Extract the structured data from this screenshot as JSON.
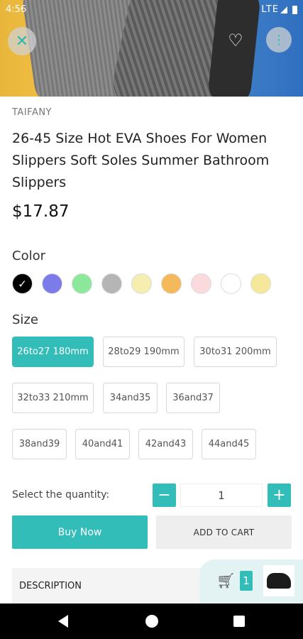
{
  "status": {
    "time": "4:56",
    "network": "LTE"
  },
  "product": {
    "brand": "TAIFANY",
    "title": "26-45 Size Hot EVA Shoes For Women Slippers Soft Soles Summer Bathroom Slippers",
    "price": "$17.87"
  },
  "color_section": {
    "label": "Color",
    "selected_index": 0,
    "swatches": [
      "#000000",
      "#7b7bea",
      "#8ee89b",
      "#b5b5b5",
      "#f5eeb0",
      "#f3b95a",
      "#fadadd",
      "#ffffff",
      "#f6e89a"
    ]
  },
  "size_section": {
    "label": "Size",
    "options": [
      "26to27 180mm",
      "28to29 190mm",
      "30to31 200mm",
      "32to33 210mm",
      "34and35",
      "36and37",
      "38and39",
      "40and41",
      "42and43",
      "44and45"
    ],
    "selected_index": 0
  },
  "quantity": {
    "label": "Select the quantity:",
    "value": "1",
    "minus": "−",
    "plus": "+"
  },
  "actions": {
    "buy_now": "Buy Now",
    "add_to_cart": "ADD TO CART"
  },
  "description": {
    "label": "DESCRIPTION"
  },
  "cart": {
    "count": "1"
  },
  "icons": {
    "close": "close-icon",
    "heart": "heart-icon",
    "more": "more-vert-icon",
    "cart": "cart-icon",
    "check": "check-icon"
  },
  "colors": {
    "accent": "#33bdb8"
  }
}
